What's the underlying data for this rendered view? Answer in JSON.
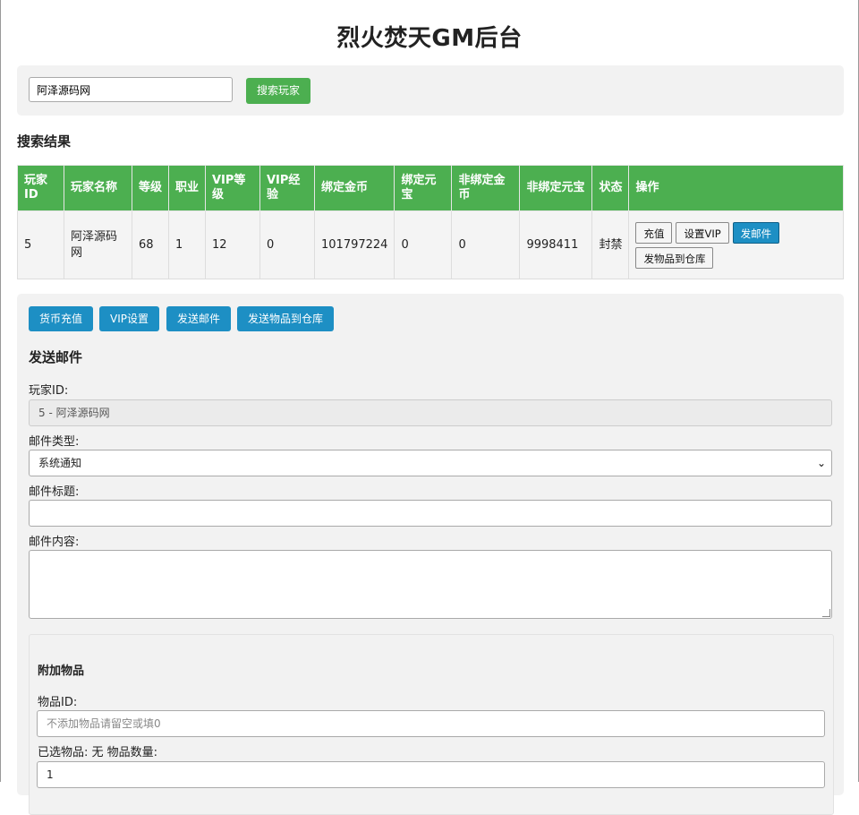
{
  "page_title": "烈火焚天GM后台",
  "search": {
    "value": "阿泽源码网",
    "button": "搜索玩家"
  },
  "results": {
    "title": "搜索结果",
    "headers": [
      "玩家ID",
      "玩家名称",
      "等级",
      "职业",
      "VIP等级",
      "VIP经验",
      "绑定金币",
      "绑定元宝",
      "非绑定金币",
      "非绑定元宝",
      "状态",
      "操作"
    ],
    "row": {
      "id": "5",
      "name": "阿泽源码网",
      "level": "68",
      "job": "1",
      "vip_level": "12",
      "vip_exp": "0",
      "bound_gold": "101797224",
      "bound_yuanbao": "0",
      "unbound_gold": "0",
      "unbound_yuanbao": "9998411",
      "status": "封禁"
    },
    "actions": [
      "充值",
      "设置VIP",
      "发邮件",
      "发物品到仓库"
    ]
  },
  "tabs": [
    "货币充值",
    "VIP设置",
    "发送邮件",
    "发送物品到仓库"
  ],
  "mail_form": {
    "heading": "发送邮件",
    "player_id_label": "玩家ID:",
    "player_id_value": "5 - 阿泽源码网",
    "type_label": "邮件类型:",
    "type_value": "系统通知",
    "subject_label": "邮件标题:",
    "subject_value": "",
    "content_label": "邮件内容:",
    "content_value": "",
    "attachment": {
      "heading": "附加物品",
      "item_id_label": "物品ID:",
      "item_id_placeholder": "不添加物品请留空或填0",
      "selected_label": "已选物品: 无 物品数量:",
      "quantity_value": "1"
    }
  },
  "colors": {
    "green": "#4caf50",
    "blue": "#1d8fc4",
    "panel": "#f2f2f2"
  }
}
